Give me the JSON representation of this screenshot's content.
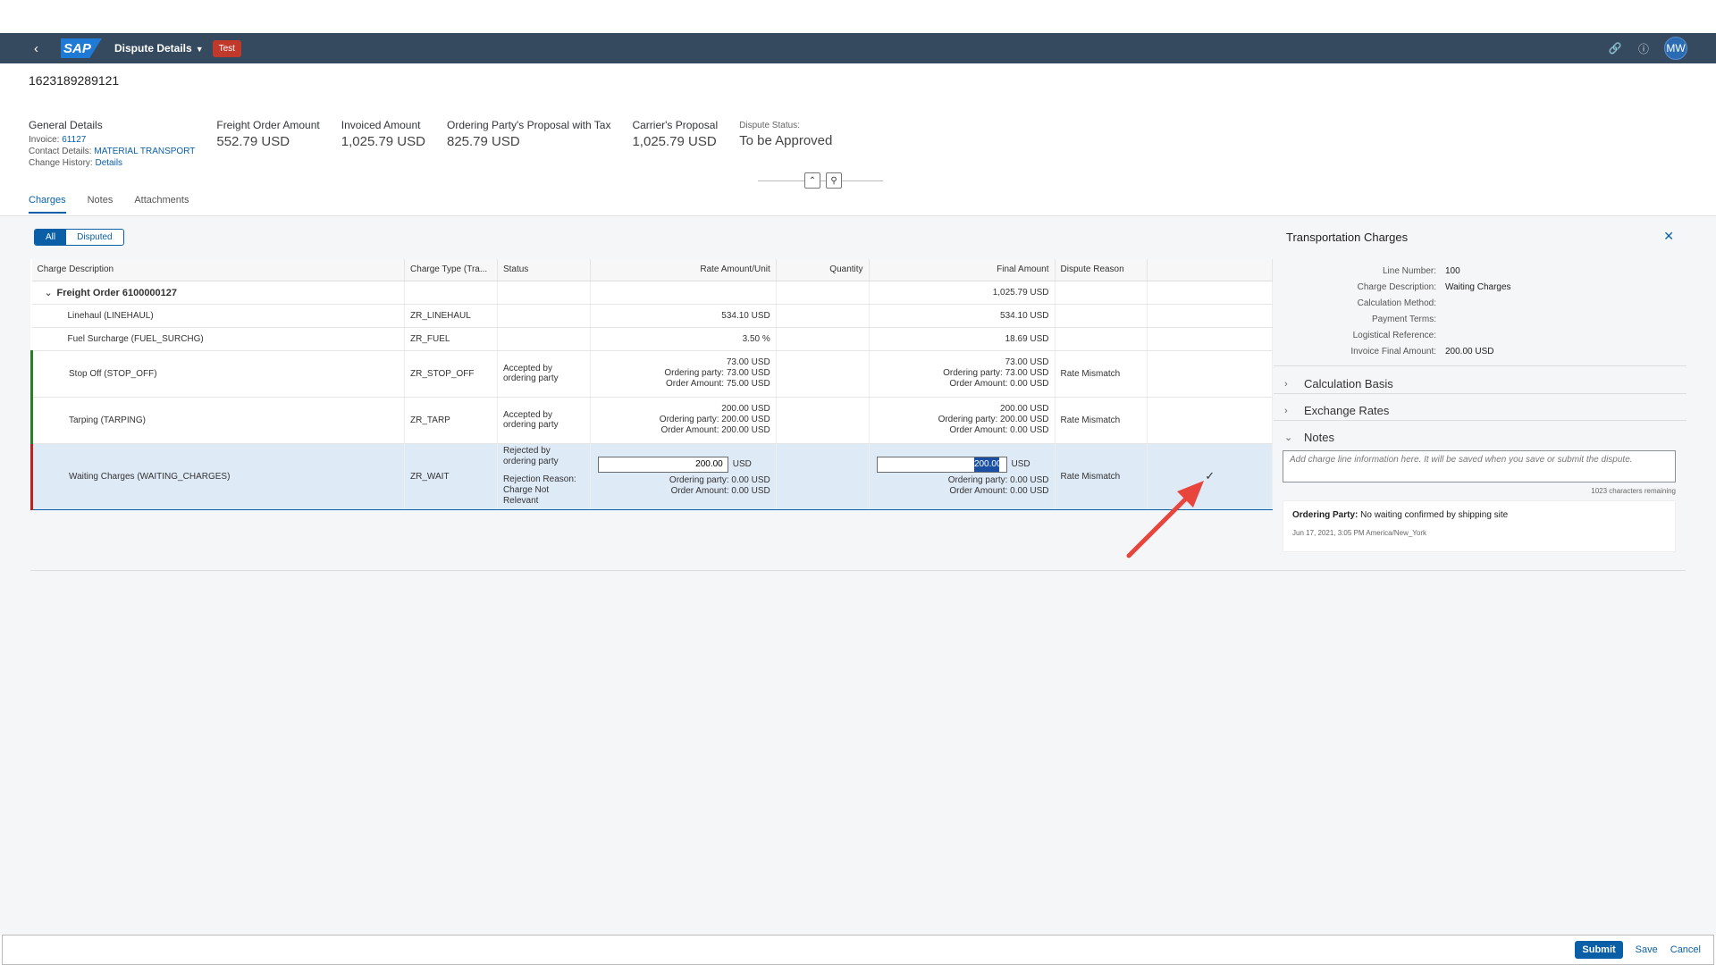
{
  "shell": {
    "app_title": "Dispute Details",
    "badge": "Test",
    "logo_text": "SAP",
    "back_icon": "chevron-left-icon",
    "avatar_initials": "MW"
  },
  "header": {
    "object_id": "1623189289121",
    "general": {
      "label": "General Details",
      "invoice_label": "Invoice:",
      "invoice_value": "61127",
      "contact_label": "Contact Details:",
      "contact_value": "MATERIAL TRANSPORT",
      "history_label": "Change History:",
      "history_value": "Details"
    },
    "kpis": [
      {
        "label": "Freight Order Amount",
        "value": "552.79 USD"
      },
      {
        "label": "Invoiced Amount",
        "value": "1,025.79 USD"
      },
      {
        "label": "Ordering Party's Proposal with Tax",
        "value": "825.79 USD"
      },
      {
        "label": "Carrier's Proposal",
        "value": "1,025.79 USD"
      }
    ],
    "status_label": "Dispute Status:",
    "status_value": "To be Approved"
  },
  "tabs": [
    "Charges",
    "Notes",
    "Attachments"
  ],
  "filter": {
    "all": "All",
    "disputed": "Disputed"
  },
  "table": {
    "columns": [
      "Charge Description",
      "Charge Type (Tra...",
      "Status",
      "Rate Amount/Unit",
      "Quantity",
      "Final Amount",
      "Dispute Reason"
    ],
    "group": {
      "label": "Freight Order 6100000127",
      "final": "1,025.79 USD"
    },
    "rows": [
      {
        "desc": "Linehaul (LINEHAUL)",
        "type": "ZR_LINEHAUL",
        "rate": "534.10 USD",
        "final": "534.10 USD"
      },
      {
        "desc": "Fuel Surcharge (FUEL_SURCHG)",
        "type": "ZR_FUEL",
        "rate": "3.50 %",
        "final": "18.69 USD"
      },
      {
        "desc": "Stop Off (STOP_OFF)",
        "type": "ZR_STOP_OFF",
        "status": "Accepted by ordering party",
        "rate": "73.00 USD",
        "rate_op": "Ordering party: 73.00 USD",
        "rate_oa": "Order Amount: 75.00 USD",
        "final": "73.00 USD",
        "final_op": "Ordering party: 73.00 USD",
        "final_oa": "Order Amount: 0.00 USD",
        "reason": "Rate Mismatch"
      },
      {
        "desc": "Tarping (TARPING)",
        "type": "ZR_TARP",
        "status": "Accepted by ordering party",
        "rate": "200.00 USD",
        "rate_op": "Ordering party: 200.00 USD",
        "rate_oa": "Order Amount: 200.00 USD",
        "final": "200.00 USD",
        "final_op": "Ordering party: 200.00 USD",
        "final_oa": "Order Amount: 0.00 USD",
        "reason": "Rate Mismatch"
      },
      {
        "desc": "Waiting Charges (WAITING_CHARGES)",
        "type": "ZR_WAIT",
        "status": "Rejected by ordering party",
        "rejection": "Rejection Reason: Charge Not Relevant",
        "rate_input": "200.00",
        "rate_cur": "USD",
        "rate_op": "Ordering party: 0.00 USD",
        "rate_oa": "Order Amount: 0.00 USD",
        "final_input": "200.00",
        "final_cur": "USD",
        "final_op": "Ordering party: 0.00 USD",
        "final_oa": "Order Amount: 0.00 USD",
        "reason": "Rate Mismatch"
      }
    ]
  },
  "panel": {
    "title": "Transportation Charges",
    "fields": [
      {
        "label": "Line Number:",
        "value": "100"
      },
      {
        "label": "Charge Description:",
        "value": "Waiting Charges"
      },
      {
        "label": "Calculation Method:",
        "value": ""
      },
      {
        "label": "Payment Terms:",
        "value": ""
      },
      {
        "label": "Logistical Reference:",
        "value": ""
      },
      {
        "label": "Invoice Final Amount:",
        "value": "200.00 USD"
      }
    ],
    "sections": [
      "Calculation Basis",
      "Exchange Rates",
      "Notes"
    ],
    "note_placeholder": "Add charge line information here. It will be saved when you save or submit the dispute.",
    "char_remaining": "1023 characters remaining",
    "note_author": "Ordering Party:",
    "note_text": "No waiting confirmed by shipping site",
    "note_date": "Jun 17, 2021, 3:05 PM America/New_York"
  },
  "footer": {
    "submit": "Submit",
    "save": "Save",
    "cancel": "Cancel"
  },
  "colors": {
    "shell": "#354a5f",
    "accent": "#0a5fa6",
    "badge": "#c0392b",
    "success": "#2b7c2b",
    "error": "#bb2222",
    "arrow": "#e8453c"
  }
}
